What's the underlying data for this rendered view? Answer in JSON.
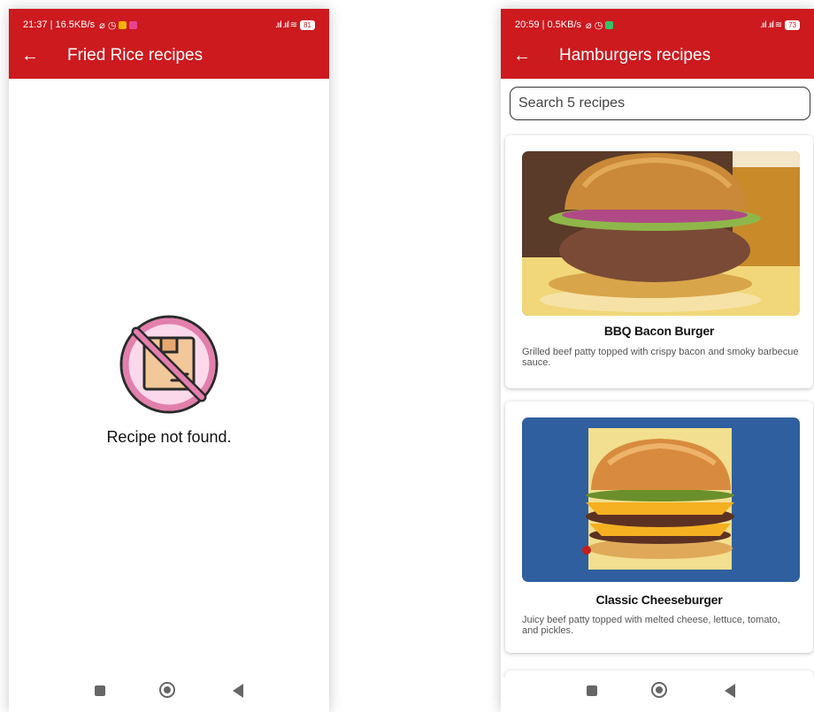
{
  "left_screen": {
    "status": {
      "time_net": "21:37 | 16.5KB/s",
      "icons": "⌀ ◷",
      "signal": ".ııl .ııl ≋",
      "battery": "81"
    },
    "app_bar": {
      "back_icon": "arrow-left-icon",
      "title": "Fried Rice recipes"
    },
    "empty_state": {
      "icon": "no-recipe-icon",
      "message": "Recipe not found."
    },
    "nav": {
      "recent": "square-icon",
      "home": "circle-icon",
      "back": "triangle-back-icon"
    }
  },
  "right_screen": {
    "status": {
      "time_net": "20:59 | 0.5KB/s",
      "icons": "⌀ ◷",
      "signal": ".ııl .ııl ≋",
      "battery": "73"
    },
    "app_bar": {
      "back_icon": "arrow-left-icon",
      "title": "Hamburgers recipes"
    },
    "search": {
      "placeholder": "Search 5 recipes",
      "value": ""
    },
    "recipes": [
      {
        "title": "BBQ Bacon Burger",
        "description": "Grilled beef patty topped with crispy bacon and smoky barbecue sauce.",
        "image": "burger-photo"
      },
      {
        "title": "Classic Cheeseburger",
        "description": "Juicy beef patty topped with melted cheese, lettuce, tomato, and pickles.",
        "image": "cheeseburger-photo"
      }
    ],
    "nav": {
      "recent": "square-icon",
      "home": "circle-icon",
      "back": "triangle-back-icon"
    }
  },
  "colors": {
    "primary": "#cc1a1f",
    "background": "#ffffff",
    "text": "#111111",
    "muted_text": "#555555"
  }
}
